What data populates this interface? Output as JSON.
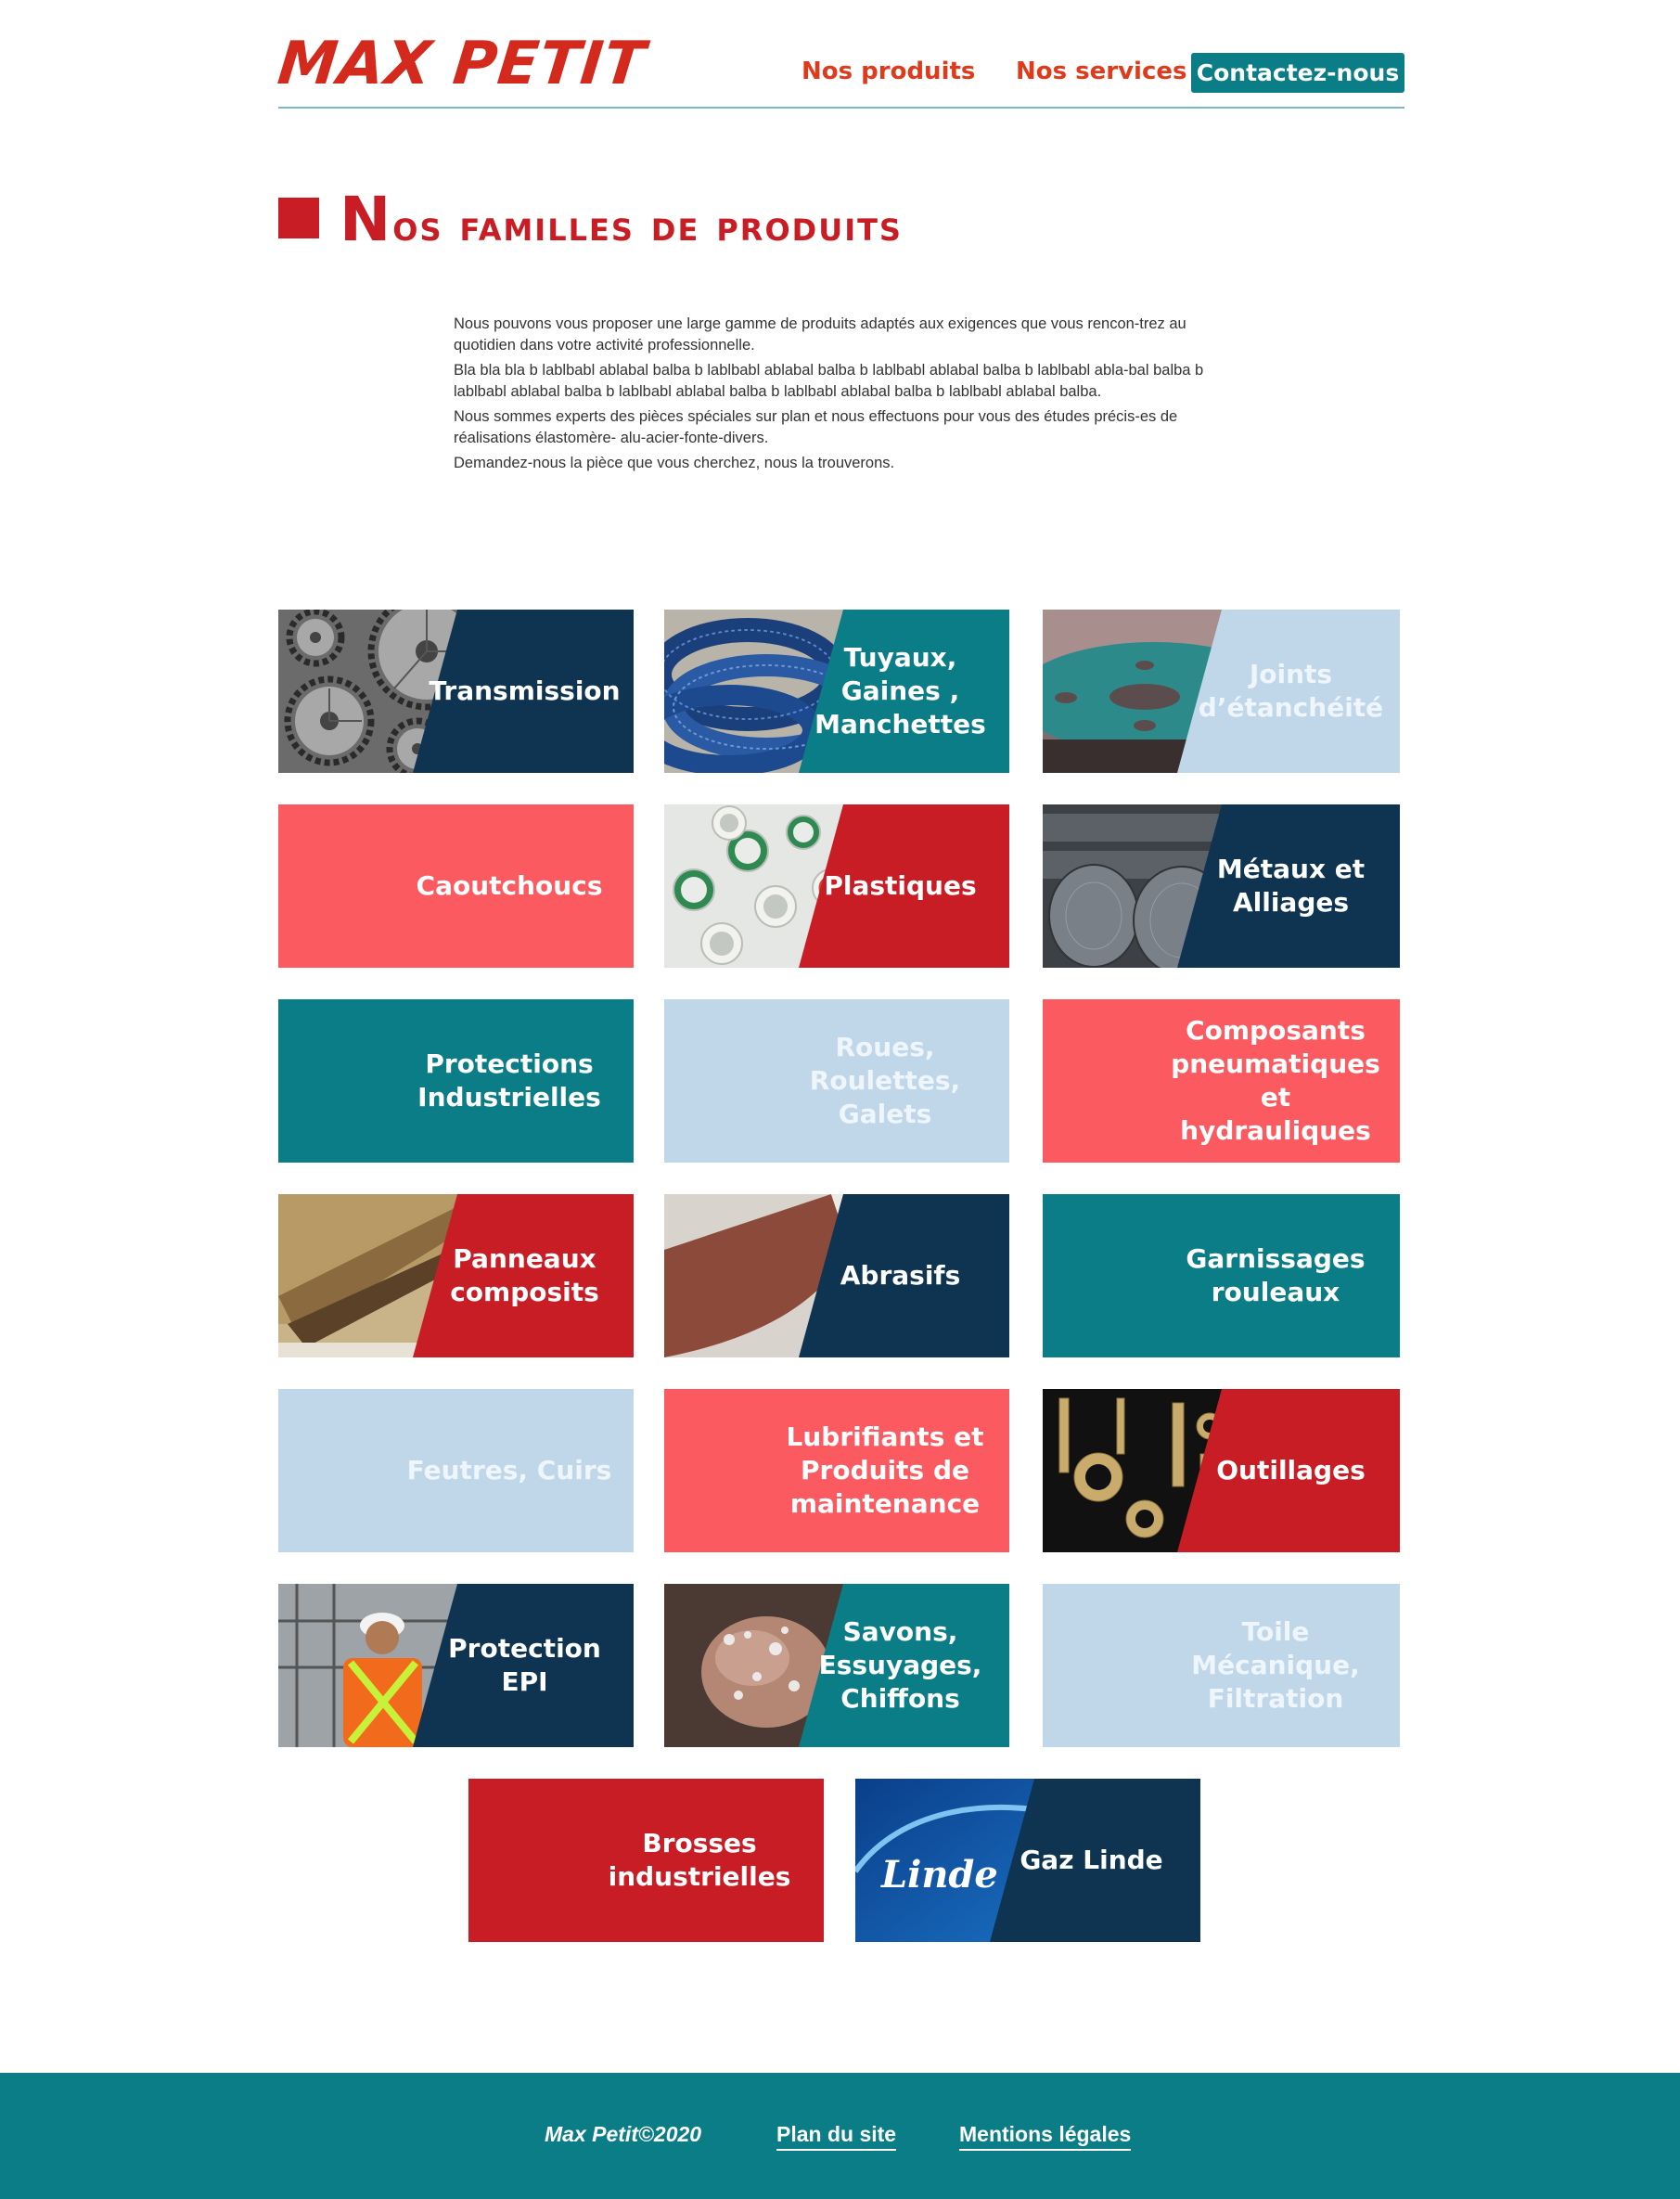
{
  "brand": {
    "logo_text": "MAX PETIT"
  },
  "nav": {
    "products_label": "Nos produits",
    "services_label": "Nos services",
    "contact_label": "Contactez-nous"
  },
  "page": {
    "title_first_letter": "N",
    "title_rest": "os familles de produits",
    "intro": [
      "Nous pouvons vous proposer une large gamme de produits adaptés aux exigences que vous rencon-trez au quotidien dans votre activité professionnelle.",
      "Bla bla bla b lablbabl ablabal  balba b lablbabl ablabal  balba  b lablbabl ablabal  balba  b lablbabl abla-bal  balba  b lablbabl ablabal balba  b lablbabl ablabal balba  b lablbabl ablabal  balba  b lablbabl ablabal balba.",
      "Nous sommes experts des pièces spéciales sur plan et nous effectuons pour vous des études précis-es de réalisations élastomère- alu-acier-fonte-divers.",
      "Demandez-nous la pièce que vous cherchez, nous la trouverons."
    ]
  },
  "colors": {
    "navy": "#0e3451",
    "teal": "#0a7d86",
    "light_blue": "#c0d7ea",
    "coral": "#fb5a61",
    "red": "#c81d25",
    "brand_red": "#d42a1e"
  },
  "products": [
    {
      "label": "Transmission",
      "color": "#0e3451",
      "photo": "gears"
    },
    {
      "label": "Tuyaux,\nGaines ,\nManchettes",
      "color": "#0a7d86",
      "photo": "hoses"
    },
    {
      "label": "Joints\nd’étanchéité",
      "color": "#c0d7ea",
      "photo": "gasket"
    },
    {
      "label": "Caoutchoucs",
      "color": "#fb5a61",
      "photo": ""
    },
    {
      "label": "Plastiques",
      "color": "#c81d25",
      "photo": "pipes"
    },
    {
      "label": "Métaux et\nAlliages",
      "color": "#0e3451",
      "photo": "metal-bars"
    },
    {
      "label": "Protections\nIndustrielles",
      "color": "#0a7d86",
      "photo": ""
    },
    {
      "label": "Roues,\nRoulettes,\nGalets",
      "color": "#c0d7ea",
      "photo": ""
    },
    {
      "label": "Composants\npneumatiques\net hydrauliques",
      "color": "#fb5a61",
      "photo": ""
    },
    {
      "label": "Panneaux\ncomposits",
      "color": "#c81d25",
      "photo": "panels"
    },
    {
      "label": "Abrasifs",
      "color": "#0e3451",
      "photo": "sandpaper"
    },
    {
      "label": "Garnissages\nrouleaux",
      "color": "#0a7d86",
      "photo": ""
    },
    {
      "label": "Feutres, Cuirs",
      "color": "#c0d7ea",
      "photo": ""
    },
    {
      "label": "Lubrifiants et\nProduits de\nmaintenance",
      "color": "#fb5a61",
      "photo": ""
    },
    {
      "label": "Outillages",
      "color": "#c81d25",
      "photo": "tools"
    },
    {
      "label": "Protection EPI",
      "color": "#0e3451",
      "photo": "worker"
    },
    {
      "label": "Savons,\nEssuyages,\nChiffons",
      "color": "#0a7d86",
      "photo": "hands"
    },
    {
      "label": "Toile\nMécanique,\nFiltration",
      "color": "#c0d7ea",
      "photo": ""
    },
    {
      "label": "Brosses\nindustrielles",
      "color": "#c81d25",
      "photo": ""
    },
    {
      "label": "Gaz Linde",
      "color": "#0e3451",
      "photo": "linde-logo",
      "logo_text": "Linde"
    }
  ],
  "footer": {
    "copyright": "Max Petit©2020",
    "sitemap_label": "Plan du site",
    "legal_label": "Mentions légales"
  }
}
